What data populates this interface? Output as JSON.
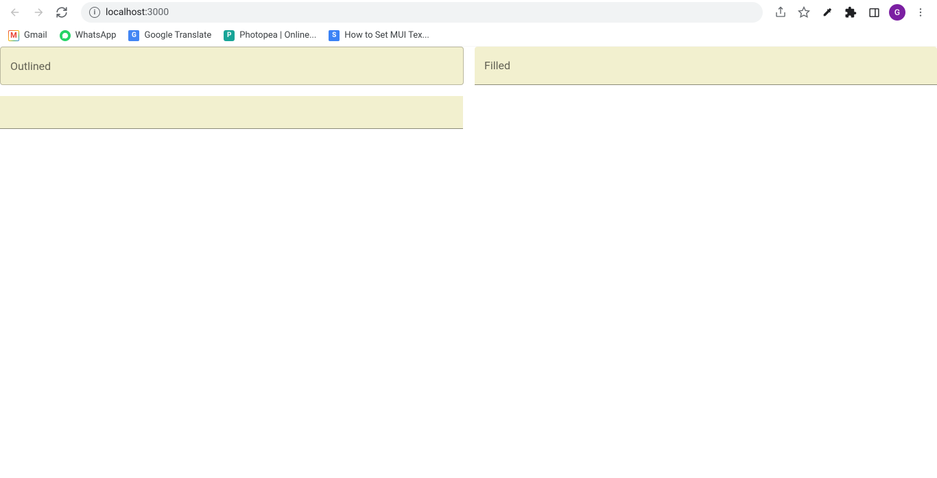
{
  "browser": {
    "url_host": "localhost:",
    "url_port": "3000",
    "avatar_letter": "G"
  },
  "bookmarks": [
    {
      "label": "Gmail",
      "icon": "gmail"
    },
    {
      "label": "WhatsApp",
      "icon": "whatsapp"
    },
    {
      "label": "Google Translate",
      "icon": "gtranslate"
    },
    {
      "label": "Photopea | Online...",
      "icon": "photopea"
    },
    {
      "label": "How to Set MUI Tex...",
      "icon": "so"
    }
  ],
  "fields": {
    "outlined_label": "Outlined",
    "filled_label": "Filled",
    "standard_label": ""
  },
  "colors": {
    "field_bg": "#f2f0cf",
    "avatar_bg": "#7b1fa2"
  }
}
